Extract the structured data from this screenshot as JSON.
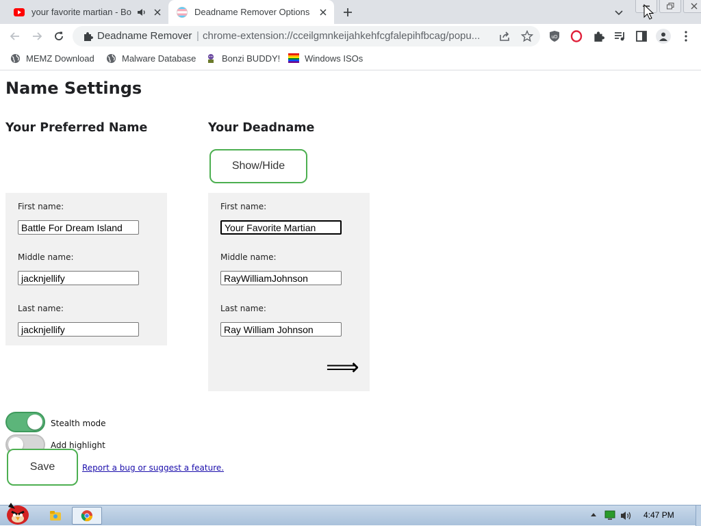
{
  "tabs": [
    {
      "title": "your favorite martian - Bo",
      "favicon": "youtube-icon",
      "audio": true,
      "active": false
    },
    {
      "title": "Deadname Remover Options",
      "favicon": "trans-flag-icon",
      "active": true
    }
  ],
  "toolbar": {
    "omnibox_name": "Deadname Remover",
    "omnibox_separator": "|",
    "omnibox_url": "chrome-extension://cceilgmnkeijahkehfcgfalepihfbcag/popu..."
  },
  "bookmarks": [
    {
      "label": "MEMZ Download",
      "icon": "globe-icon"
    },
    {
      "label": "Malware Database",
      "icon": "globe-icon"
    },
    {
      "label": "Bonzi BUDDY!",
      "icon": "bonzi-icon"
    },
    {
      "label": "Windows ISOs",
      "icon": "rainbow-flag-icon"
    }
  ],
  "page": {
    "title": "Name Settings",
    "preferred_heading": "Your Preferred Name",
    "deadname_heading": "Your Deadname",
    "show_hide_label": "Show/Hide",
    "labels": {
      "first": "First name:",
      "middle": "Middle name:",
      "last": "Last name:"
    },
    "preferred": {
      "first": "Battle For Dream Island",
      "middle": "jacknjellify",
      "last": "jacknjellify"
    },
    "deadname": {
      "first": "Your Favorite Martian",
      "middle": "RayWilliamJohnson",
      "last": "Ray William Johnson"
    },
    "arrow": "⟹",
    "stealth_label": "Stealth mode",
    "stealth_on": true,
    "highlight_label": "Add highlight",
    "highlight_on": false,
    "save_label": "Save",
    "report_link": "Report a bug or suggest a feature."
  },
  "taskbar": {
    "clock": "4:47 PM"
  },
  "colors": {
    "accent_green": "#4caf50",
    "switch_on": "#5cb57a",
    "tabstrip": "#dee1e6",
    "panel_bg": "#f1f1f1",
    "link": "#1a0dab"
  }
}
